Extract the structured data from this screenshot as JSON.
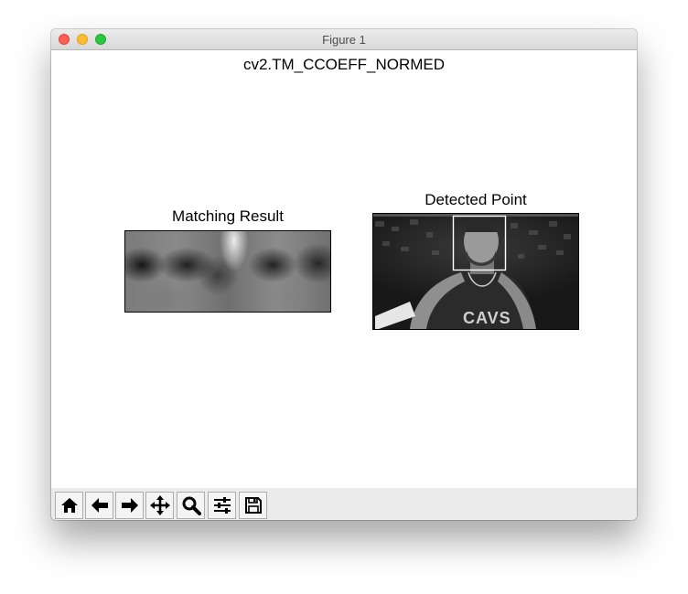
{
  "window": {
    "title": "Figure 1",
    "buttons": [
      "close",
      "minimize",
      "zoom"
    ]
  },
  "figure": {
    "suptitle": "cv2.TM_CCOEFF_NORMED",
    "subplots": [
      {
        "title": "Matching Result",
        "content": "grayscale-heatmap",
        "ticks": "off"
      },
      {
        "title": "Detected Point",
        "content": "grayscale-photo-with-rectangle",
        "ticks": "off"
      }
    ]
  },
  "toolbar": {
    "buttons": [
      {
        "icon": "home-icon",
        "name": "home"
      },
      {
        "icon": "back-arrow-icon",
        "name": "back"
      },
      {
        "icon": "forward-arrow-icon",
        "name": "forward"
      },
      {
        "icon": "pan-icon",
        "name": "pan"
      },
      {
        "icon": "zoom-icon",
        "name": "zoom"
      },
      {
        "icon": "subplots-icon",
        "name": "configure-subplots"
      },
      {
        "icon": "save-icon",
        "name": "save"
      }
    ]
  },
  "colors": {
    "titlebar": "#dcdcdc",
    "close": "#fd5f57",
    "minimize": "#febc2e",
    "zoom": "#28c840",
    "toolbar": "#ececec",
    "detection_box": "#ffffff"
  }
}
